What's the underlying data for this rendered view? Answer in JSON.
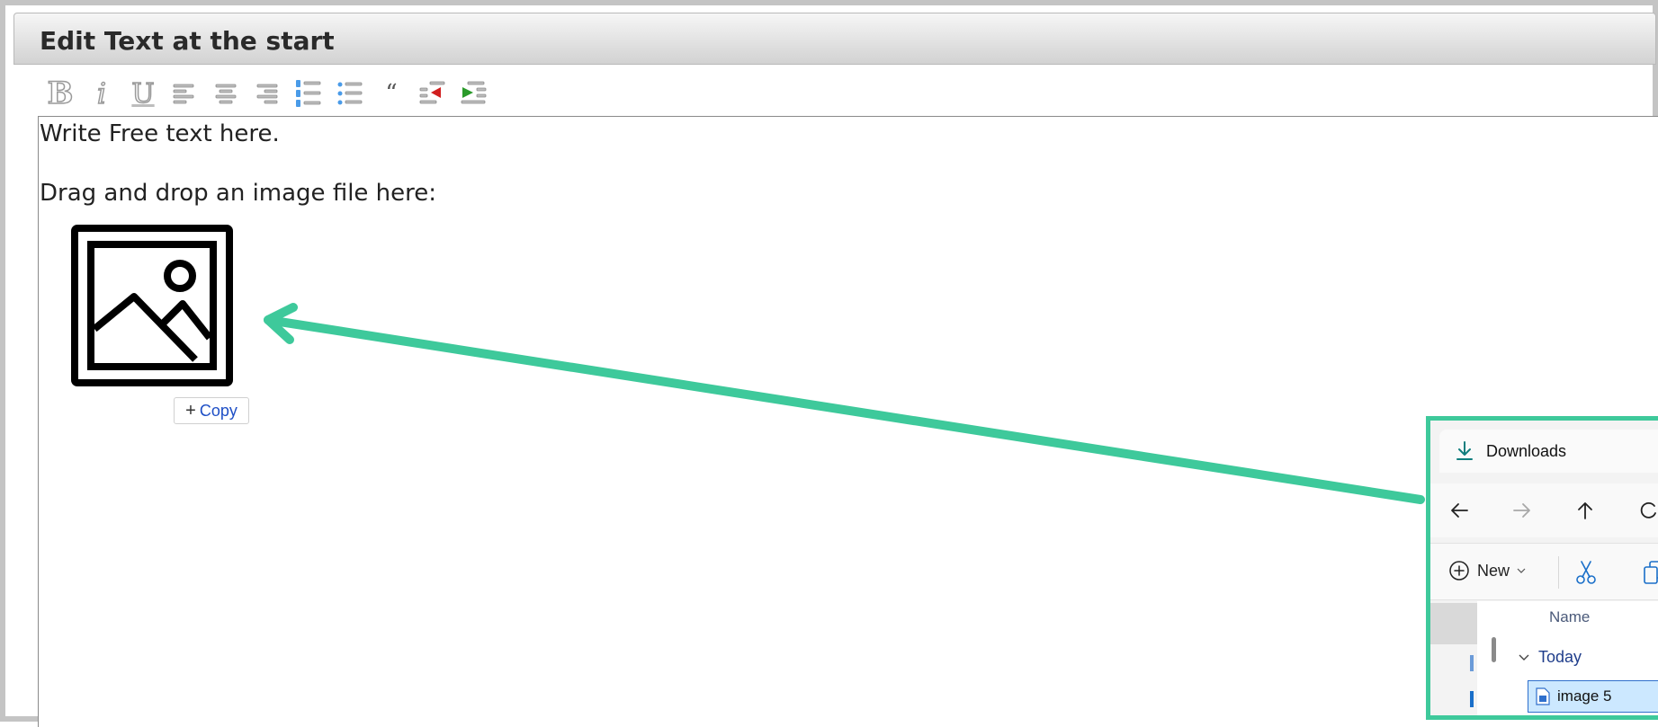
{
  "window": {
    "title": "Edit Text at the start"
  },
  "toolbar": {
    "buttons": [
      {
        "name": "bold-button",
        "glyph": "B"
      },
      {
        "name": "italic-button",
        "glyph": "i"
      },
      {
        "name": "underline-button",
        "glyph": "U"
      },
      {
        "name": "align-left-button",
        "icon": "align-left-icon"
      },
      {
        "name": "align-center-button",
        "icon": "align-center-icon"
      },
      {
        "name": "align-right-button",
        "icon": "align-right-icon"
      },
      {
        "name": "ordered-list-button",
        "icon": "ordered-list-icon"
      },
      {
        "name": "unordered-list-button",
        "icon": "unordered-list-icon"
      },
      {
        "name": "blockquote-button",
        "glyph": "“"
      },
      {
        "name": "outdent-button",
        "icon": "outdent-icon"
      },
      {
        "name": "indent-button",
        "icon": "indent-icon"
      }
    ]
  },
  "editor": {
    "line1": "Write Free text here.",
    "line2": "Drag and drop an image file here:",
    "image_icon": "image-placeholder-icon",
    "copy_label": "Copy"
  },
  "annotation": {
    "color": "#3ec99b"
  },
  "explorer": {
    "tab_title": "Downloads",
    "new_label": "New",
    "column_name": "Name",
    "group_label": "Today",
    "file_name": "image 5"
  }
}
